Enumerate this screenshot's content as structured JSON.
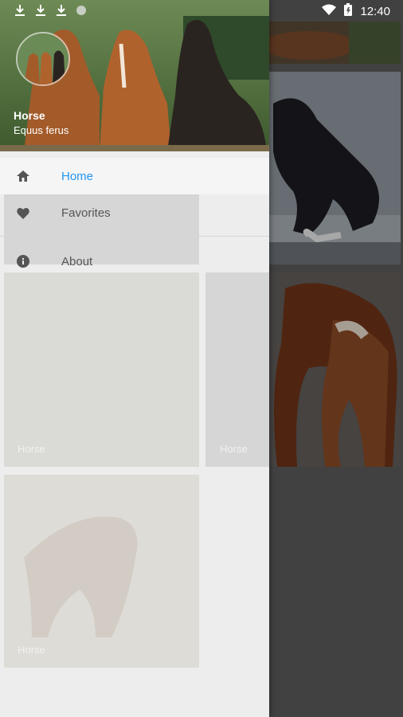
{
  "status_bar": {
    "time": "12:40"
  },
  "drawer": {
    "header": {
      "title": "Horse",
      "subtitle": "Equus ferus"
    },
    "menu": [
      {
        "label": "Home",
        "icon": "home-icon",
        "active": true
      },
      {
        "label": "Favorites",
        "icon": "heart-icon",
        "active": false
      },
      {
        "label": "About",
        "icon": "info-icon",
        "active": false
      }
    ]
  },
  "gallery": {
    "tile_caption": "Horse"
  },
  "colors": {
    "accent": "#2196f3",
    "drawer_bg": "#ededed",
    "scrim": "#5a5a5a"
  }
}
